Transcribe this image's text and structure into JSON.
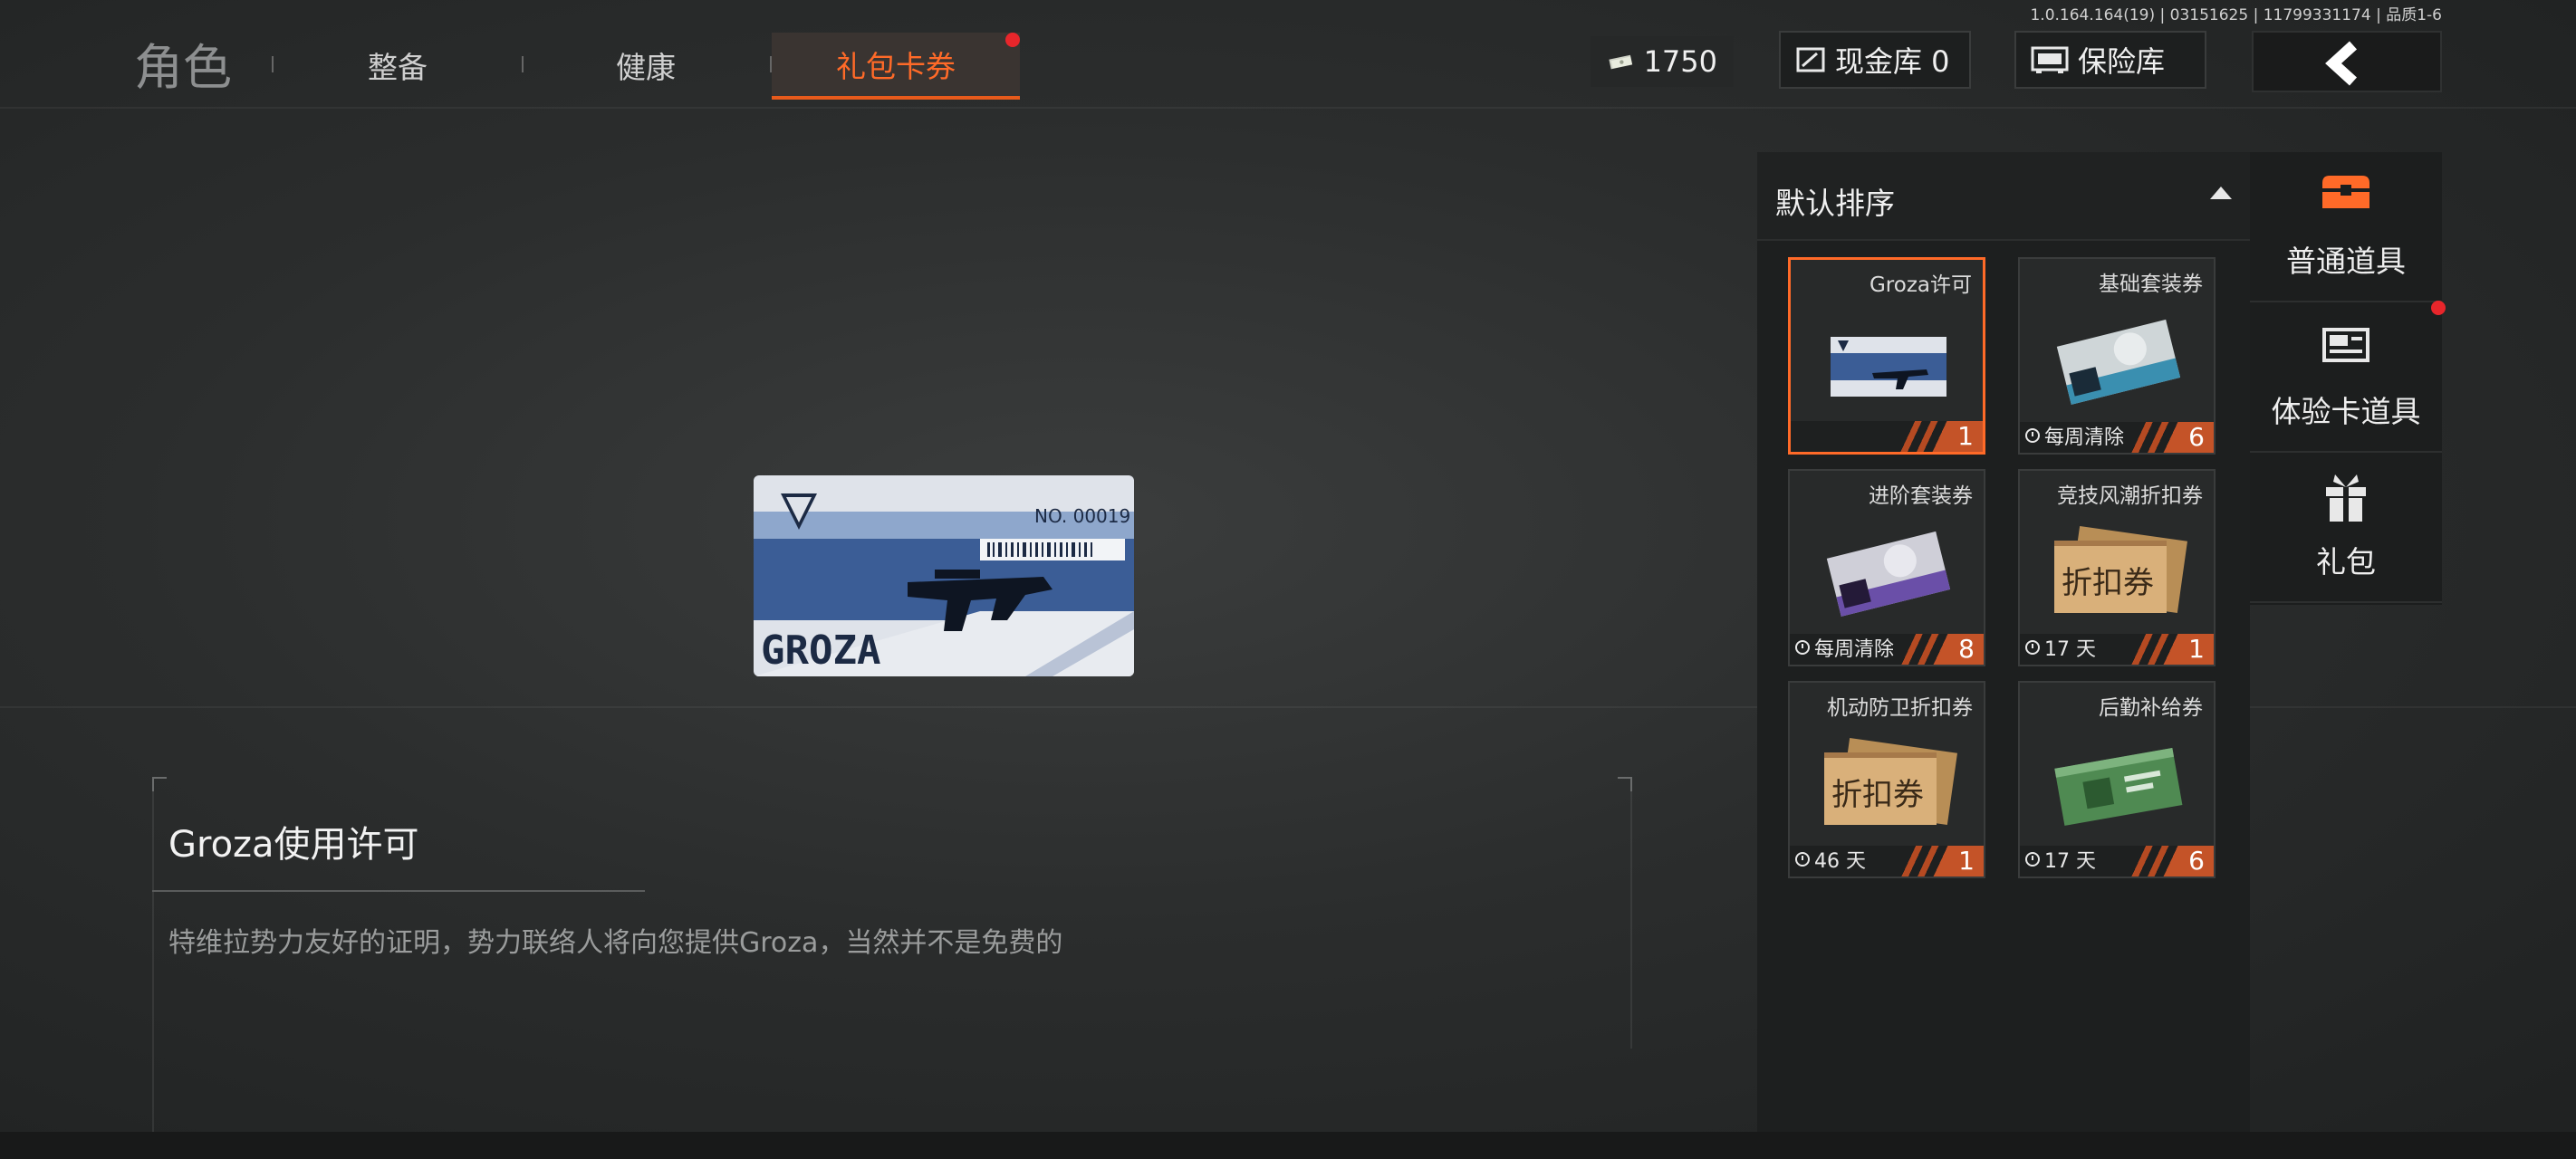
{
  "version": "1.0.164.164(19) | 03151625 | 11799331174 | 品质1-6",
  "header": {
    "title": "角色",
    "tabs": [
      {
        "label": "整备"
      },
      {
        "label": "健康"
      },
      {
        "label": "礼包卡券",
        "active": true
      }
    ]
  },
  "currency": {
    "amount": "1750"
  },
  "cash_vault": {
    "label": "现金库 0"
  },
  "safe_vault": {
    "label": "保险库"
  },
  "selected_item": {
    "card_number": "NO. 00019",
    "card_logo_text": "GROZA",
    "title": "Groza使用许可",
    "description": "特维拉势力友好的证明，势力联络人将向您提供Groza，当然并不是免费的"
  },
  "sort": {
    "label": "默认排序"
  },
  "items": [
    {
      "name": "Groza许可",
      "timer": "",
      "count": "1",
      "selected": true
    },
    {
      "name": "基础套装券",
      "timer": "每周清除",
      "count": "6"
    },
    {
      "name": "进阶套装券",
      "timer": "每周清除",
      "count": "8"
    },
    {
      "name": "竞技风潮折扣券",
      "timer": "17 天",
      "count": "1"
    },
    {
      "name": "机动防卫折扣券",
      "timer": "46 天",
      "count": "1"
    },
    {
      "name": "后勤补给券",
      "timer": "17 天",
      "count": "6"
    }
  ],
  "coupon_text": "折扣券",
  "categories": [
    {
      "label": "普通道具",
      "icon": "chest-icon"
    },
    {
      "label": "体验卡道具",
      "icon": "card-icon"
    },
    {
      "label": "礼包",
      "icon": "gift-icon"
    }
  ],
  "colors": {
    "accent": "#ff6a28",
    "badge_red": "#e8262b",
    "count_bg": "#c45328"
  }
}
